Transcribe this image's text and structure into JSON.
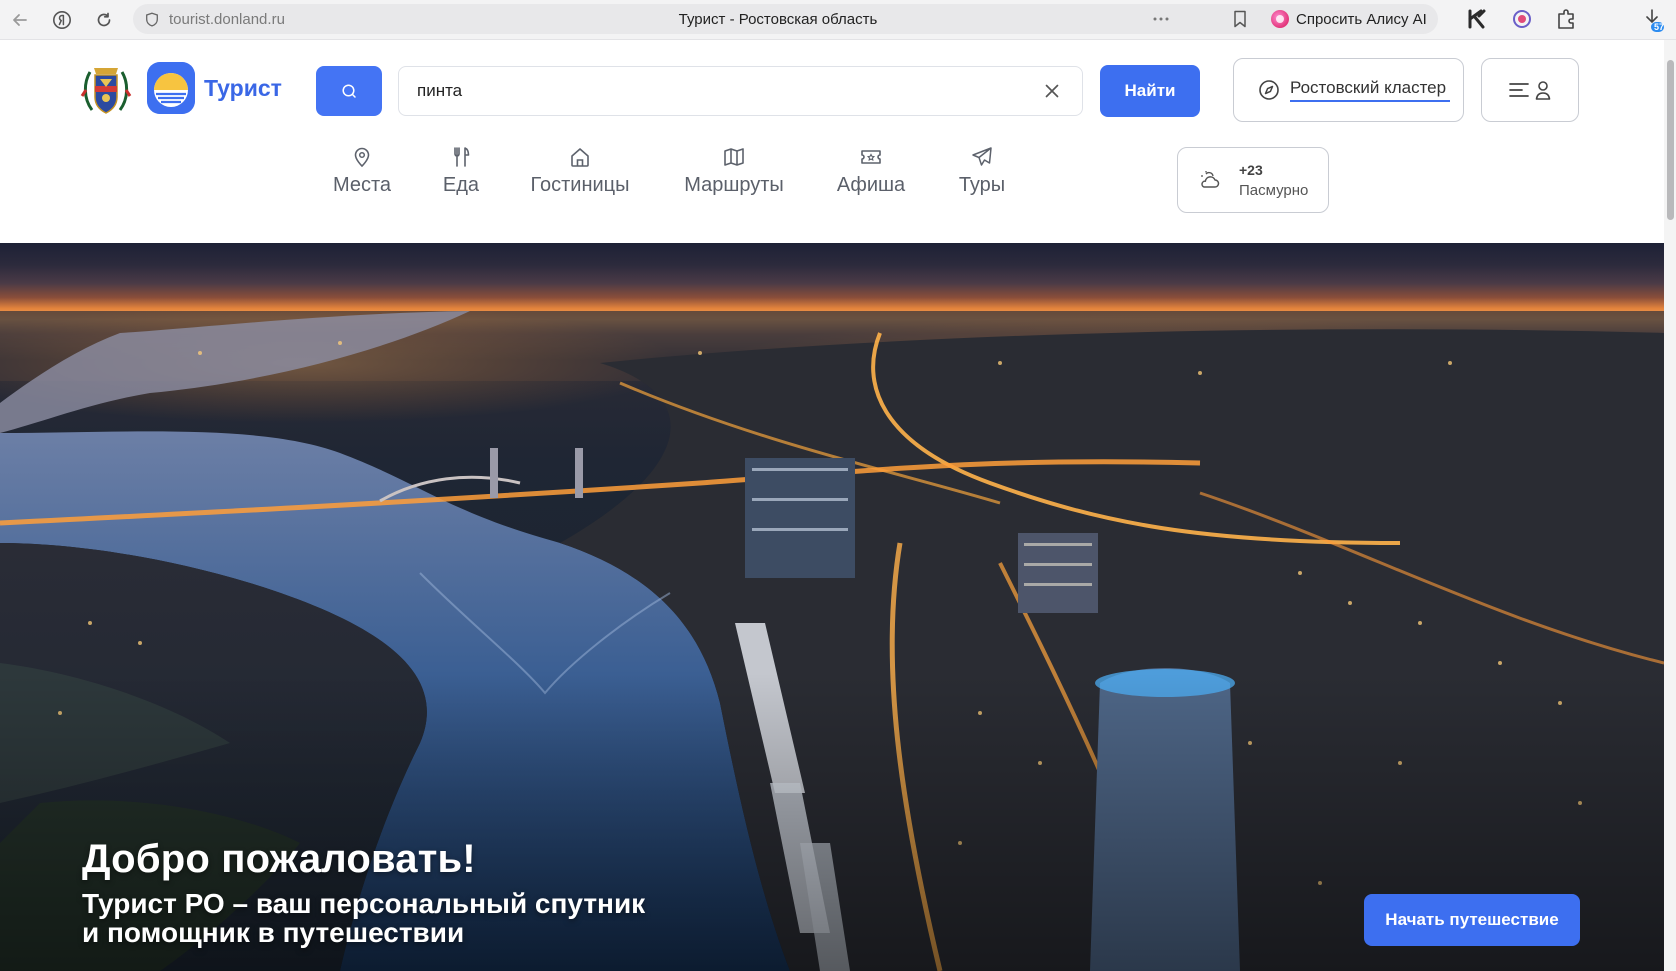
{
  "browser": {
    "url": "tourist.donland.ru",
    "tab_title": "Турист - Ростовская область",
    "alice_label": "Спросить Алису AI",
    "download_badge": "57"
  },
  "header": {
    "logo_text": "Турист",
    "search_value": "пинта",
    "find_label": "Найти",
    "region_label": "Ростовский кластер"
  },
  "nav": [
    {
      "label": "Места",
      "icon": "map-pin-icon"
    },
    {
      "label": "Еда",
      "icon": "fork-knife-icon"
    },
    {
      "label": "Гостиницы",
      "icon": "house-icon"
    },
    {
      "label": "Маршруты",
      "icon": "map-icon"
    },
    {
      "label": "Афиша",
      "icon": "ticket-icon"
    },
    {
      "label": "Туры",
      "icon": "plane-icon"
    }
  ],
  "weather": {
    "temp": "+23",
    "condition": "Пасмурно"
  },
  "hero": {
    "title": "Добро пожаловать!",
    "subtitle_line1": "Турист РО – ваш персональный спутник",
    "subtitle_line2": "и помощник в путешествии",
    "cta_label": "Начать путешествие"
  },
  "colors": {
    "accent": "#3d6ff0",
    "accent_logo": "#3a67e6"
  }
}
